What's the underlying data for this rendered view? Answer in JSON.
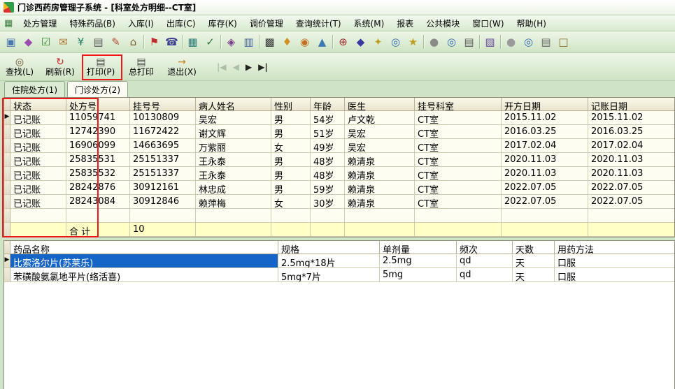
{
  "window": {
    "title": "门诊西药房管理子系统 - [科室处方明细--CT室]"
  },
  "menu": {
    "items": [
      "处方管理",
      "特殊药品(B)",
      "入库(I)",
      "出库(C)",
      "库存(K)",
      "调价管理",
      "查询统计(T)",
      "系统(M)",
      "报表",
      "公共模块",
      "窗口(W)",
      "帮助(H)"
    ]
  },
  "toolbar": {
    "groups": [
      [
        {
          "name": "rx-document-icon",
          "glyph": "▣",
          "color": "#4a78b0"
        },
        {
          "name": "drug-bottle-icon",
          "glyph": "◆",
          "color": "#9a4ab0"
        },
        {
          "name": "audit-check-icon",
          "glyph": "☑",
          "color": "#2e8b2e"
        },
        {
          "name": "mail-icon",
          "glyph": "✉",
          "color": "#b07830"
        },
        {
          "name": "fee-icon",
          "glyph": "¥",
          "color": "#1f7a5c"
        },
        {
          "name": "print-icon",
          "glyph": "▤",
          "color": "#5a5a5a"
        },
        {
          "name": "edit-icon",
          "glyph": "✎",
          "color": "#b05030"
        },
        {
          "name": "home-icon",
          "glyph": "⌂",
          "color": "#7a5c2e"
        }
      ],
      [
        {
          "name": "flag-icon",
          "glyph": "⚑",
          "color": "#c03030"
        },
        {
          "name": "phone-icon",
          "glyph": "☎",
          "color": "#3f3f8f"
        }
      ],
      [
        {
          "name": "grid-icon",
          "glyph": "▦",
          "color": "#2e7a7a"
        },
        {
          "name": "check-icon",
          "glyph": "✓",
          "color": "#2e7a2e"
        }
      ],
      [
        {
          "name": "card-icon",
          "glyph": "◈",
          "color": "#7a3a8a"
        },
        {
          "name": "list-icon",
          "glyph": "▥",
          "color": "#46689a"
        }
      ],
      [
        {
          "name": "barcode-icon",
          "glyph": "▩",
          "color": "#333333"
        },
        {
          "name": "bell-icon",
          "glyph": "♦",
          "color": "#d09020"
        },
        {
          "name": "clock-icon",
          "glyph": "◉",
          "color": "#c07020"
        },
        {
          "name": "chart-icon",
          "glyph": "▲",
          "color": "#3a7ab0"
        }
      ],
      [
        {
          "name": "plus-icon",
          "glyph": "⊕",
          "color": "#a03030"
        },
        {
          "name": "gem-icon",
          "glyph": "◆",
          "color": "#3a3aa0"
        },
        {
          "name": "key-icon",
          "glyph": "✦",
          "color": "#c0a020"
        },
        {
          "name": "search-doc-icon",
          "glyph": "◎",
          "color": "#2e6ab0"
        },
        {
          "name": "star-icon",
          "glyph": "★",
          "color": "#c0a020"
        }
      ],
      [
        {
          "name": "sphere-icon",
          "glyph": "●",
          "color": "#8a8a8a"
        },
        {
          "name": "zoom-icon",
          "glyph": "◎",
          "color": "#2e6ab0"
        },
        {
          "name": "report-icon",
          "glyph": "▤",
          "color": "#5a5a5a"
        }
      ],
      [
        {
          "name": "pattern-icon",
          "glyph": "▧",
          "color": "#6a4aa0"
        }
      ],
      [
        {
          "name": "ball-icon",
          "glyph": "●",
          "color": "#9a9a9a"
        },
        {
          "name": "magnifier-icon",
          "glyph": "◎",
          "color": "#2e6ab0"
        },
        {
          "name": "sheet-icon",
          "glyph": "▤",
          "color": "#666666"
        },
        {
          "name": "notebook-icon",
          "glyph": "□",
          "color": "#8a6a2a"
        }
      ]
    ]
  },
  "actions": {
    "buttons": [
      {
        "name": "find-button",
        "label": "查找(L)",
        "icon": "binoculars-icon",
        "glyph": "◎",
        "color": "#6a5026"
      },
      {
        "name": "refresh-button",
        "label": "刷新(R)",
        "icon": "refresh-icon",
        "glyph": "↻",
        "color": "#cc2020"
      },
      {
        "name": "print-button",
        "label": "打印(P)",
        "icon": "printer-icon",
        "glyph": "▤",
        "color": "#444444"
      },
      {
        "name": "print-all-button",
        "label": "总打印",
        "icon": "printer-icon",
        "glyph": "▤",
        "color": "#444444"
      },
      {
        "name": "exit-button",
        "label": "退出(X)",
        "icon": "exit-icon",
        "glyph": "→",
        "color": "#c08020"
      }
    ],
    "nav": [
      {
        "name": "first",
        "glyph": "|◀",
        "enabled": false
      },
      {
        "name": "prev",
        "glyph": "◀",
        "enabled": false
      },
      {
        "name": "next",
        "glyph": "▶",
        "enabled": true
      },
      {
        "name": "last",
        "glyph": "▶|",
        "enabled": true
      }
    ]
  },
  "tabs": [
    {
      "label": "住院处方(1)",
      "active": false
    },
    {
      "label": "门诊处方(2)",
      "active": true
    }
  ],
  "prescriptions": {
    "columns": [
      "状态",
      "处方号",
      "挂号号",
      "病人姓名",
      "性别",
      "年龄",
      "医生",
      "挂号科室",
      "开方日期",
      "记账日期"
    ],
    "rows": [
      [
        "已记账",
        "11059741",
        "10130809",
        "吴宏",
        "男",
        "54岁",
        "卢文乾",
        "CT室",
        "2015.11.02",
        "2015.11.02"
      ],
      [
        "已记账",
        "12742390",
        "11672422",
        "谢文辉",
        "男",
        "51岁",
        "吴宏",
        "CT室",
        "2016.03.25",
        "2016.03.25"
      ],
      [
        "已记账",
        "16906099",
        "14663695",
        "万紫丽",
        "女",
        "49岁",
        "吴宏",
        "CT室",
        "2017.02.04",
        "2017.02.04"
      ],
      [
        "已记账",
        "25835531",
        "25151337",
        "王永泰",
        "男",
        "48岁",
        "赖清泉",
        "CT室",
        "2020.11.03",
        "2020.11.03"
      ],
      [
        "已记账",
        "25835532",
        "25151337",
        "王永泰",
        "男",
        "48岁",
        "赖清泉",
        "CT室",
        "2020.11.03",
        "2020.11.03"
      ],
      [
        "已记账",
        "28242876",
        "30912161",
        "林忠成",
        "男",
        "59岁",
        "赖清泉",
        "CT室",
        "2022.07.05",
        "2022.07.05"
      ],
      [
        "已记账",
        "28243084",
        "30912846",
        "赖萍梅",
        "女",
        "30岁",
        "赖清泉",
        "CT室",
        "2022.07.05",
        "2022.07.05"
      ]
    ],
    "summary": {
      "label": "合  计",
      "total": "10"
    }
  },
  "drugs": {
    "columns": [
      "药品名称",
      "规格",
      "单剂量",
      "频次",
      "天数",
      "用药方法"
    ],
    "rows": [
      {
        "cells": [
          "比索洛尔片(苏莱乐)",
          "2.5mg*18片",
          "2.5mg",
          "qd",
          "天",
          "口服"
        ],
        "selected": true
      },
      {
        "cells": [
          "苯磺酸氨氯地平片(络活喜)",
          "5mg*7片",
          "5mg",
          "qd",
          "天",
          "口服"
        ],
        "selected": false
      }
    ]
  },
  "colors": {
    "selection": "#1565c8",
    "annotation": "#f01818"
  }
}
